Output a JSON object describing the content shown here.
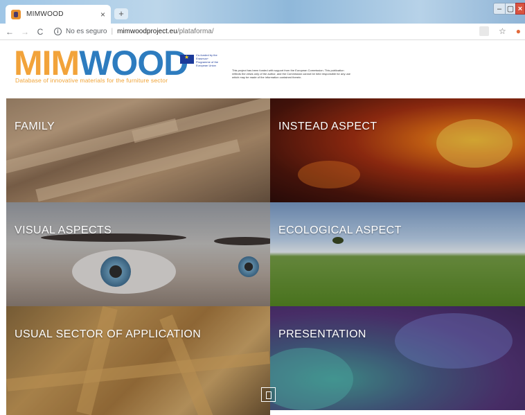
{
  "browser": {
    "tab_title": "MIMWOOD",
    "tab_close": "×",
    "new_tab": "+",
    "back": "←",
    "forward": "→",
    "reload": "C",
    "security_label": "No es seguro",
    "url_host": "mimwoodproject.eu",
    "url_path": "/plataforma/",
    "star": "☆",
    "window_min": "–",
    "window_max": "▢",
    "window_close": "×"
  },
  "header": {
    "logo_part1": "MIM",
    "logo_part2": "WOOD",
    "logo_subtitle": "Database of innovative materials for the furniture sector",
    "eu_text": "Co-funded by the Erasmus+ Programme of the European Union",
    "disclaimer": "This project has been funded with support from the European Commission. This publication reflects the views only of the author, and the Commission cannot be held responsible for any use which may be made of the information contained therein."
  },
  "tiles": [
    {
      "label": "FAMILY"
    },
    {
      "label": "INSTEAD ASPECT"
    },
    {
      "label": "VISUAL ASPECTS"
    },
    {
      "label": "ECOLOGICAL ASPECT"
    },
    {
      "label": "USUAL SECTOR OF APPLICATION"
    },
    {
      "label": "PRESENTATION"
    }
  ],
  "colors": {
    "logo_orange": "#f2a33a",
    "logo_blue": "#2d7cbf",
    "eu_blue": "#1b3a9a"
  },
  "icons": {
    "favicon": "mimwood-favicon-icon",
    "info": "info-icon",
    "star": "star-icon",
    "extension": "extension-icon",
    "profile": "profile-icon",
    "scroll": "scroll-down-icon"
  }
}
